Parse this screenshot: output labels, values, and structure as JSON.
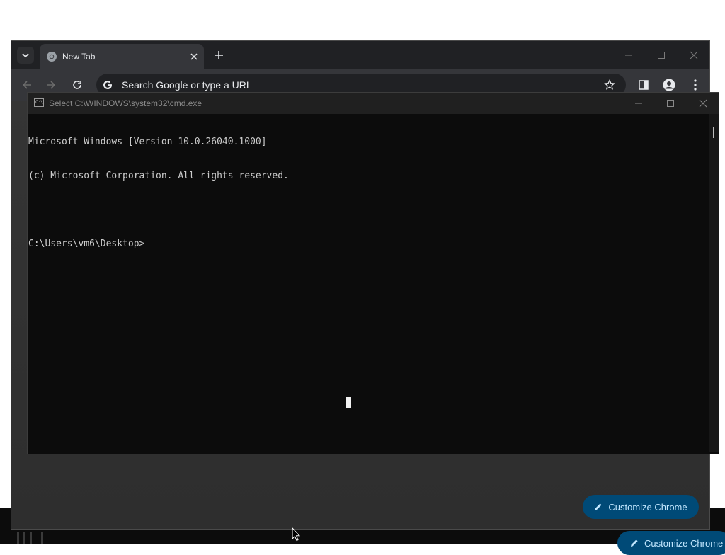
{
  "browser": {
    "tab_title": "New Tab",
    "omnibox_placeholder": "Search Google or type a URL",
    "customize_label": "Customize Chrome"
  },
  "cmd": {
    "title": "Select C:\\WINDOWS\\system32\\cmd.exe",
    "icon_text": "C:\\",
    "lines": [
      "Microsoft Windows [Version 10.0.26040.1000]",
      "(c) Microsoft Corporation. All rights reserved.",
      "",
      "C:\\Users\\vm6\\Desktop>"
    ]
  },
  "colors": {
    "accent_button": "#004a77",
    "console_text": "#cccccc",
    "console_bg": "#0c0c0c"
  },
  "icons": [
    "tab-search-icon",
    "chrome-favicon-icon",
    "close-icon",
    "plus-icon",
    "minimize-icon",
    "maximize-icon",
    "back-icon",
    "forward-icon",
    "reload-icon",
    "google-g-icon",
    "star-icon",
    "side-panel-icon",
    "profile-icon",
    "kebab-menu-icon",
    "pencil-icon",
    "cmd-icon",
    "mouse-pointer-icon"
  ]
}
